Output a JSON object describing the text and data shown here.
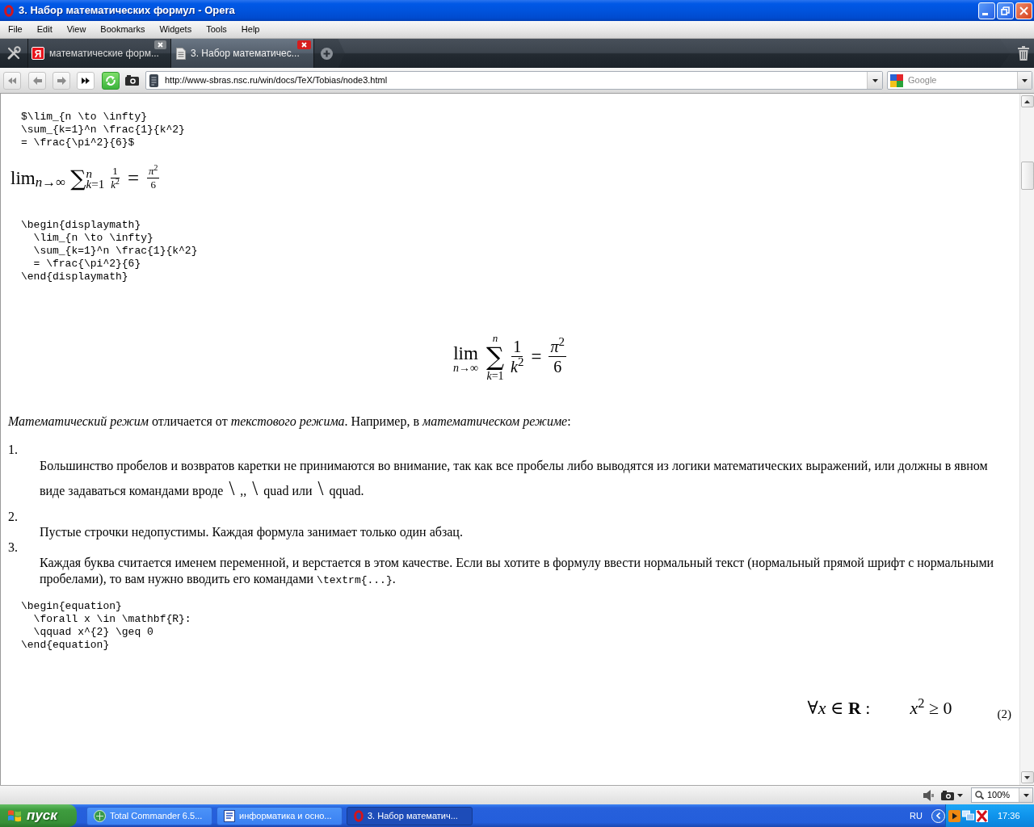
{
  "window": {
    "title": "3. Набор математических формул - Opera"
  },
  "menu": [
    "File",
    "Edit",
    "View",
    "Bookmarks",
    "Widgets",
    "Tools",
    "Help"
  ],
  "tabs": [
    {
      "kind": "logo",
      "logo_text": "Я",
      "title": "математические форм...",
      "selected": false
    },
    {
      "kind": "page",
      "title": "3. Набор математичес...",
      "selected": true
    }
  ],
  "address_bar": {
    "url": "http://www-sbras.nsc.ru/win/docs/TeX/Tobias/node3.html"
  },
  "search_field": {
    "placeholder": "Google"
  },
  "content": [
    {
      "kind": "code",
      "lines": [
        "$\\lim_{n \\to \\infty}",
        "\\sum_{k=1}^n \\frac{1}{k^2}",
        "= \\frac{\\pi^2}{6}$"
      ]
    },
    {
      "kind": "inline_formula",
      "limit": "lim",
      "limit_sub": "*n*→∞",
      "sum": "∑",
      "sum_upper": "*n*",
      "sum_lower": "*k*=1",
      "fractions": [
        {
          "numerator": "1",
          "denominator": "*k*$^{2}$"
        },
        {
          "numerator": "*π*$^{2}$",
          "denominator": "6"
        }
      ],
      "relation": "="
    },
    {
      "kind": "code",
      "lines": [
        "\\begin{displaymath}",
        "  \\lim_{n \\to \\infty}",
        "  \\sum_{k=1}^n \\frac{1}{k^2}",
        "  = \\frac{\\pi^2}{6}",
        "\\end{displaymath}"
      ]
    },
    {
      "kind": "display_formula",
      "limit": "lim",
      "limit_sub": "*n*→∞",
      "sum": "∑",
      "sum_upper": "*n*",
      "sum_lower": "*k*=1",
      "fractions": [
        {
          "numerator": "1",
          "denominator": "*k*$^{2}$"
        },
        {
          "numerator": "*π*$^{2}$",
          "denominator": "6"
        }
      ],
      "relation": "="
    },
    {
      "kind": "paragraph",
      "text": "*Математический режим* отличается от *текстового режима*. Например, в *математическом режиме*:"
    },
    {
      "kind": "list",
      "items": [
        {
          "number": "1.",
          "segments": [
            {
              "kind": "text",
              "text": "Большинство пробелов и возвратов каретки не принимаются во внимание, так как все пробелы либо выводятся из логики математических выражений, или должны в явном виде задаваться командами вроде "
            },
            {
              "kind": "command",
              "text": "\\"
            },
            {
              "kind": "text",
              "text": " ,, "
            },
            {
              "kind": "command",
              "text": "\\"
            },
            {
              "kind": "text",
              "text": " quad или "
            },
            {
              "kind": "command",
              "text": "\\"
            },
            {
              "kind": "text",
              "text": " qquad."
            }
          ]
        },
        {
          "number": "2.",
          "segments": [
            {
              "kind": "text",
              "text": "Пустые строчки недопустимы. Каждая формула занимает только один абзац."
            }
          ]
        },
        {
          "number": "3.",
          "segments": [
            {
              "kind": "text",
              "text": "Каждая буква считается именем переменной, и верстается в этом качестве. Если вы хотите в формулу ввести нормальный текст (нормальный прямой шрифт с нормальными пробелами), то вам нужно вводить его командами "
            },
            {
              "kind": "code",
              "text": "\\textrm{...}"
            },
            {
              "kind": "text",
              "text": "."
            }
          ]
        }
      ]
    },
    {
      "kind": "code",
      "lines": [
        "\\begin{equation}",
        "  \\forall x \\in \\mathbf{R}:",
        "  \\qquad x^{2} \\geq 0",
        "\\end{equation}"
      ]
    },
    {
      "kind": "equation",
      "left": "∀*x* ∈ **R** :",
      "right": "*x*$^{2}$ ≥ 0",
      "number": "(2)"
    }
  ],
  "status_bar": {
    "zoom": "100%"
  },
  "taskbar": {
    "start": "пуск",
    "tasks": [
      {
        "kind": "commander",
        "title": "Total Commander 6.5...",
        "selected": false
      },
      {
        "kind": "document",
        "title": "информатика и осно...",
        "selected": false
      },
      {
        "kind": "browser",
        "title": "3. Набор математич...",
        "selected": true
      }
    ],
    "language": "RU",
    "clock": "17:36"
  }
}
